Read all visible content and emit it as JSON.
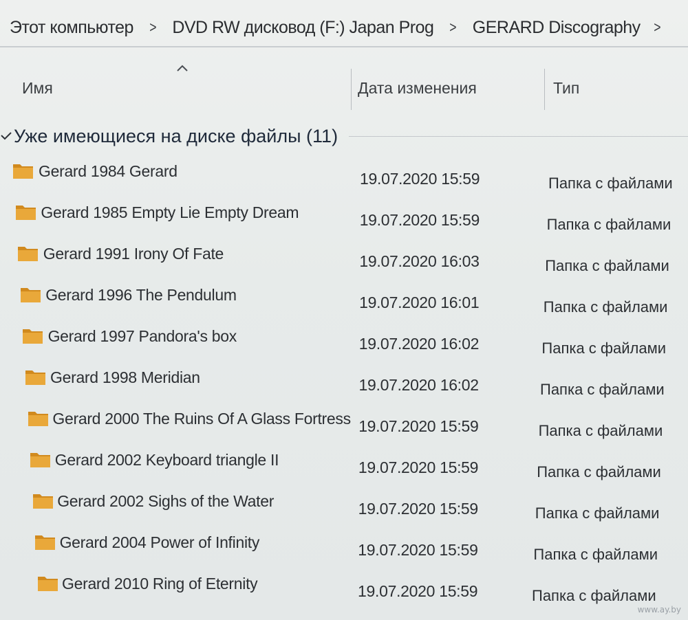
{
  "breadcrumb": {
    "items": [
      "Этот компьютер",
      "DVD RW дисковод (F:) Japan Prog",
      "GERARD Discography"
    ],
    "separator": ">"
  },
  "columns": {
    "name": "Имя",
    "date": "Дата изменения",
    "type": "Тип",
    "sorted_by": "Имя",
    "sort_direction": "ascending"
  },
  "group": {
    "title": "Уже имеющиеся на диске файлы (11)",
    "expanded": true
  },
  "files": [
    {
      "name": "Gerard 1984 Gerard",
      "date": "19.07.2020 15:59",
      "type": "Папка с файлами",
      "icon": "folder-icon"
    },
    {
      "name": "Gerard 1985 Empty Lie Empty Dream",
      "date": "19.07.2020 15:59",
      "type": "Папка с файлами",
      "icon": "folder-icon"
    },
    {
      "name": "Gerard 1991 Irony Of Fate",
      "date": "19.07.2020 16:03",
      "type": "Папка с файлами",
      "icon": "folder-icon"
    },
    {
      "name": "Gerard 1996 The Pendulum",
      "date": "19.07.2020 16:01",
      "type": "Папка с файлами",
      "icon": "folder-icon"
    },
    {
      "name": "Gerard 1997 Pandora's box",
      "date": "19.07.2020 16:02",
      "type": "Папка с файлами",
      "icon": "folder-icon"
    },
    {
      "name": "Gerard 1998 Meridian",
      "date": "19.07.2020 16:02",
      "type": "Папка с файлами",
      "icon": "folder-icon"
    },
    {
      "name": "Gerard 2000 The Ruins Of A Glass Fortress",
      "date": "19.07.2020 15:59",
      "type": "Папка с файлами",
      "icon": "folder-icon"
    },
    {
      "name": "Gerard 2002 Keyboard triangle II",
      "date": "19.07.2020 15:59",
      "type": "Папка с файлами",
      "icon": "folder-icon"
    },
    {
      "name": "Gerard 2002 Sighs of the Water",
      "date": "19.07.2020 15:59",
      "type": "Папка с файлами",
      "icon": "folder-icon"
    },
    {
      "name": "Gerard 2004 Power of Infinity",
      "date": "19.07.2020 15:59",
      "type": "Папка с файлами",
      "icon": "folder-icon"
    },
    {
      "name": "Gerard 2010 Ring of Eternity",
      "date": "19.07.2020 15:59",
      "type": "Папка с файлами",
      "icon": "folder-icon"
    }
  ],
  "watermark": "www.ay.by",
  "colors": {
    "folder_fill": "#e9a83a",
    "folder_back": "#d18a1e",
    "text": "#2c2f33",
    "background": "#e9ece9"
  }
}
